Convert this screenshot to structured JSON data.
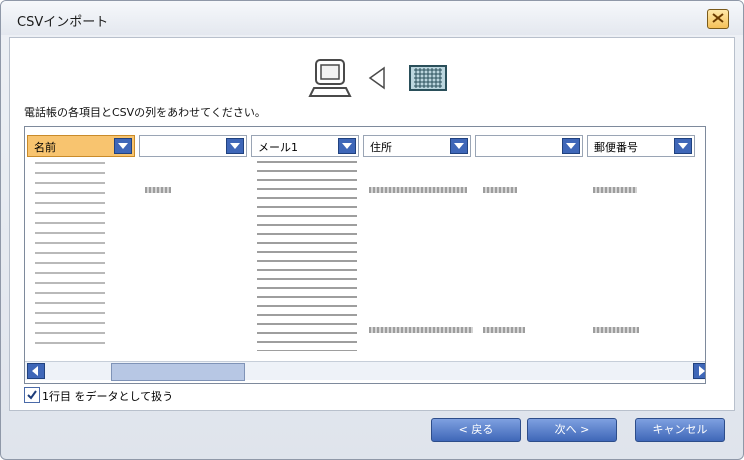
{
  "window": {
    "title": "CSVインポート"
  },
  "instruction": "電話帳の各項目とCSVの列をあわせてください。",
  "columns": [
    {
      "label": "名前",
      "selected": true
    },
    {
      "label": "",
      "selected": false
    },
    {
      "label": "メール1",
      "selected": false
    },
    {
      "label": "住所",
      "selected": false
    },
    {
      "label": "",
      "selected": false
    },
    {
      "label": "郵便番号",
      "selected": false
    }
  ],
  "checkbox": {
    "label": "1行目 をデータとして扱う",
    "checked": true
  },
  "buttons": {
    "back": "< 戻る",
    "next": "次へ >",
    "cancel": "キャンセル"
  },
  "icons": {
    "computer": "computer-icon",
    "arrow": "left-arrow-icon",
    "grid": "grid-icon",
    "close": "close-icon"
  },
  "colors": {
    "accent": "#3f67b8",
    "selectedHeader": "#f8c46f",
    "closeButton": "#f5c15a"
  }
}
